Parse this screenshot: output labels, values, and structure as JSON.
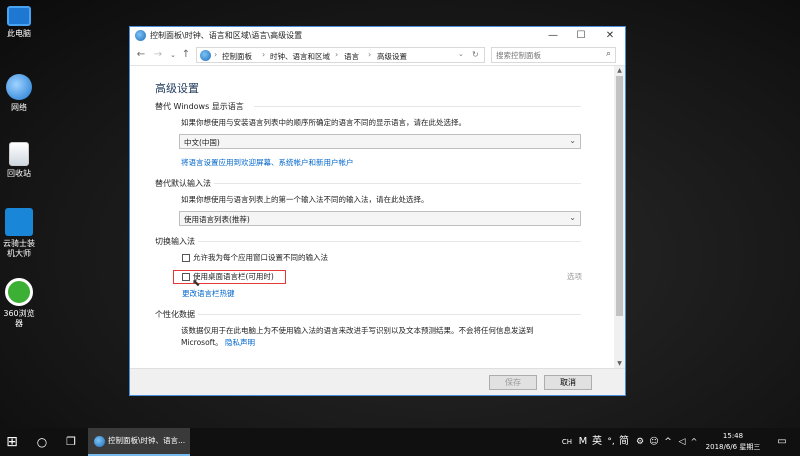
{
  "desktop": {
    "icons": [
      {
        "label": "此电脑",
        "icon": "computer-icon"
      },
      {
        "label": "网络",
        "icon": "network-icon"
      },
      {
        "label": "回收站",
        "icon": "recycle-bin-icon"
      },
      {
        "label": "云骑士装机大师",
        "icon": "yunqishi-icon"
      },
      {
        "label": "360浏览器",
        "icon": "360-browser-icon"
      }
    ]
  },
  "window": {
    "title": "控制面板\\时钟、语言和区域\\语言\\高级设置",
    "minimize": "—",
    "maximize": "☐",
    "close": "✕",
    "breadcrumb": [
      "控制面板",
      "时钟、语言和区域",
      "语言",
      "高级设置"
    ],
    "search_placeholder": "搜索控制面板",
    "heading": "高级设置",
    "display_lang": {
      "section": "替代 Windows 显示语言",
      "desc": "如果你想使用与安装语言列表中的顺序所确定的语言不同的显示语言，请在此处选择。",
      "value": "中文(中国)",
      "link": "将语言设置应用到欢迎屏幕、系统帐户和新用户帐户"
    },
    "input_method": {
      "section": "替代默认输入法",
      "desc": "如果你想使用与语言列表上的第一个输入法不同的输入法，请在此处选择。",
      "value": "使用语言列表(推荐)"
    },
    "switch_input": {
      "section": "切换输入法",
      "option1": "允许我为每个应用窗口设置不同的输入法",
      "option2": "使用桌面语言栏(可用时)",
      "options_link": "选项",
      "hotkey_link": "更改语言栏热键"
    },
    "personalization": {
      "section": "个性化数据",
      "desc_line1": "该数据仅用于在此电脑上为不使用输入法的语言来改进手写识别以及文本预测结果。不会将任何信息发送到",
      "desc_line2": "Microsoft。",
      "privacy_link": "隐私声明"
    },
    "save_button": "保存",
    "cancel_button": "取消",
    "highlight_color": "#e53935"
  },
  "taskbar": {
    "start_icon": "windows-start-icon",
    "app_label": "控制面板\\时钟、语言...",
    "tray": {
      "ch": "CH",
      "m": "M",
      "ying": "英",
      "jian": "简",
      "time": "15:48",
      "date": "2018/6/6 星期三"
    }
  }
}
